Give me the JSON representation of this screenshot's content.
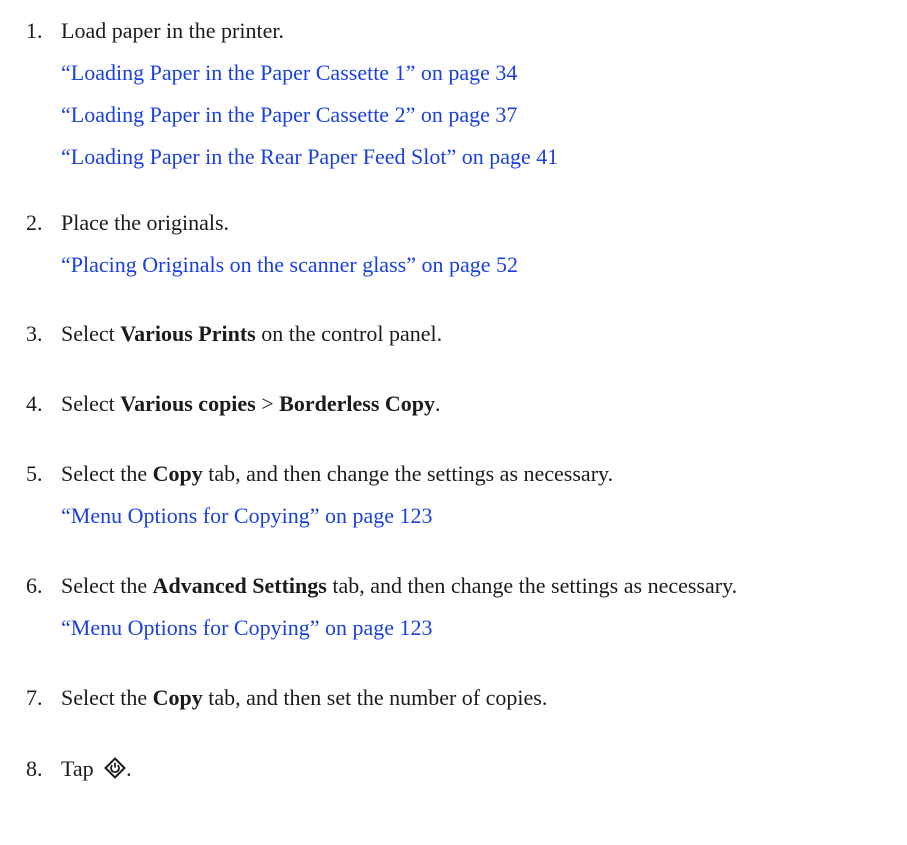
{
  "steps": [
    {
      "num": "1.",
      "text": "Load paper in the printer.",
      "links": [
        "“Loading Paper in the Paper Cassette 1” on page 34",
        "“Loading Paper in the Paper Cassette 2” on page 37",
        "“Loading Paper in the Rear Paper Feed Slot” on page 41"
      ]
    },
    {
      "num": "2.",
      "text": "Place the originals.",
      "links": [
        "“Placing Originals on the scanner glass” on page 52"
      ]
    },
    {
      "num": "3.",
      "pre": "Select ",
      "bold": "Various Prints",
      "post": " on the control panel."
    },
    {
      "num": "4.",
      "pre": "Select ",
      "bold": "Various copies",
      "mid": " > ",
      "bold2": "Borderless Copy",
      "post": "."
    },
    {
      "num": "5.",
      "pre": "Select the ",
      "bold": "Copy",
      "post": " tab, and then change the settings as necessary.",
      "links": [
        "“Menu Options for Copying” on page 123"
      ]
    },
    {
      "num": "6.",
      "pre": "Select the ",
      "bold": "Advanced Settings",
      "post": " tab, and then change the settings as necessary.",
      "links": [
        "“Menu Options for Copying” on page 123"
      ]
    },
    {
      "num": "7.",
      "pre": "Select the ",
      "bold": "Copy",
      "post": " tab, and then set the number of copies."
    },
    {
      "num": "8.",
      "pre": "Tap ",
      "icon": "start-button-icon",
      "post": "."
    }
  ],
  "colors": {
    "text": "#1b1b1b",
    "link": "#1a3fe0"
  }
}
